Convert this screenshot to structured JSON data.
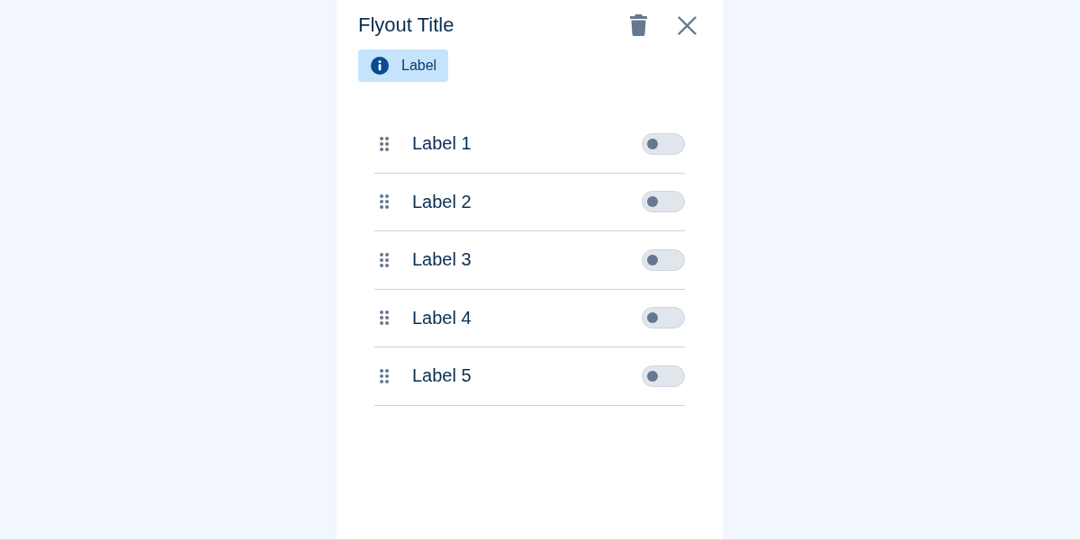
{
  "flyout": {
    "title": "Flyout Title",
    "actions": [
      {
        "kind": "delete"
      },
      {
        "kind": "close"
      }
    ],
    "badge": {
      "label": "Label"
    },
    "items": [
      {
        "label": "Label 1",
        "on": false
      },
      {
        "label": "Label 2",
        "on": false
      },
      {
        "label": "Label 3",
        "on": false
      },
      {
        "label": "Label 4",
        "on": false
      },
      {
        "label": "Label 5",
        "on": false
      }
    ]
  }
}
